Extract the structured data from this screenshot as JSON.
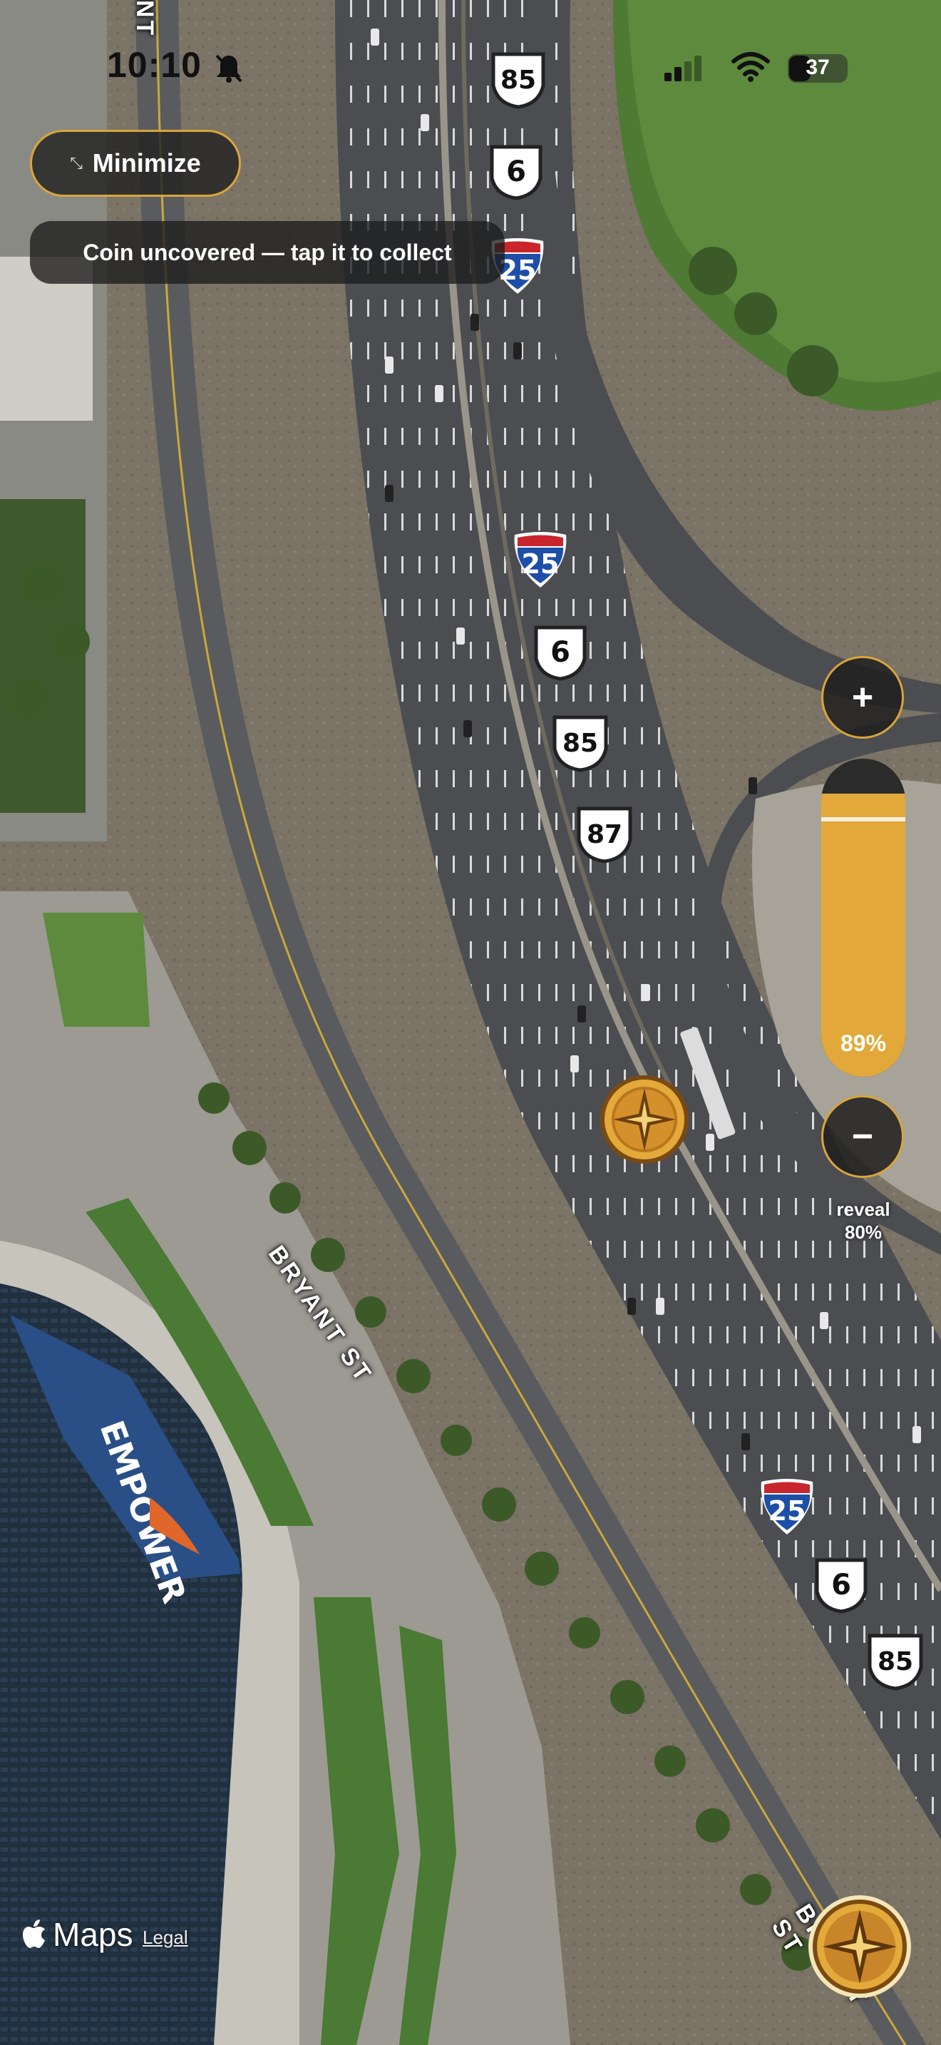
{
  "status_bar": {
    "time": "10:10",
    "battery": "37",
    "battery_level": 0.37
  },
  "minimize": {
    "label": "Minimize",
    "icon": "arrows-inward-icon"
  },
  "toast": {
    "message": "Coin uncovered — tap it to collect"
  },
  "reveal_control": {
    "zoom_in_label": "+",
    "zoom_out_label": "−",
    "percent_label": "89%",
    "percent_value": 0.89,
    "reveal_caption_line1": "reveal",
    "reveal_caption_line2": "80%"
  },
  "map": {
    "streets": [
      "BRYANT ST",
      "BRYANT ST",
      "NT"
    ],
    "stadium_text": "EMPOWER",
    "shields": {
      "interstate": "25",
      "us_6": "6",
      "us_85": "85",
      "us_87": "87"
    }
  },
  "branding": {
    "apple_maps": "Maps",
    "legal": "Legal"
  },
  "colors": {
    "accent_gold": "#d9a53b",
    "slider_fill": "#e2a93a",
    "interstate_blue": "#1d4fa8",
    "interstate_red": "#c8262c"
  }
}
